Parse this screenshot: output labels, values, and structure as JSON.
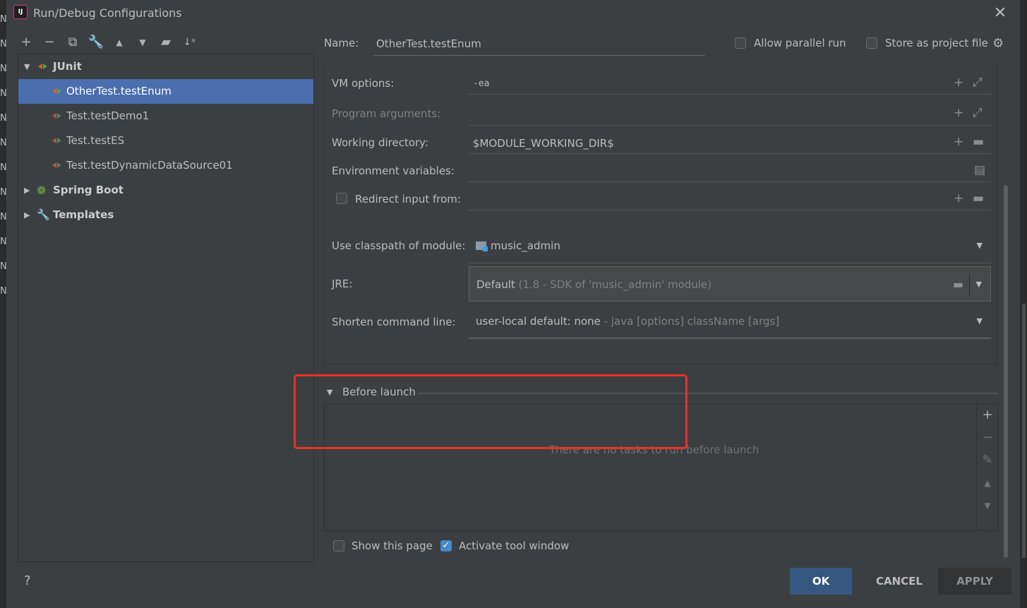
{
  "window": {
    "title": "Run/Debug Configurations",
    "app_icon": "intellij-icon",
    "close_icon": "close-icon"
  },
  "toolbar": {
    "icons": [
      "add-icon",
      "remove-icon",
      "copy-icon",
      "wrench-icon",
      "move-up-icon",
      "move-down-icon",
      "new-folder-icon",
      "sort-icon"
    ]
  },
  "tree": {
    "junit": {
      "label": "JUnit",
      "children": [
        "OtherTest.testEnum",
        "Test.testDemo1",
        "Test.testES",
        "Test.testDynamicDataSource01"
      ]
    },
    "spring_boot": "Spring Boot",
    "templates": "Templates"
  },
  "header": {
    "name_label": "Name:",
    "name_value": "OtherTest.testEnum",
    "allow_parallel": "Allow parallel run",
    "store_project": "Store as project file"
  },
  "form": {
    "vm_options_label": "VM options:",
    "vm_options_value": "-ea",
    "program_args_label": "Program arguments:",
    "program_args_value": "",
    "working_dir_label": "Working directory:",
    "working_dir_value": "$MODULE_WORKING_DIR$",
    "env_label": "Environment variables:",
    "env_value": "",
    "redirect_label": "Redirect input from:",
    "classpath_label": "Use classpath of module:",
    "classpath_value": "music_admin",
    "jre_label": "JRE:",
    "jre_value": "Default",
    "jre_hint": "(1.8 - SDK of 'music_admin' module)",
    "shorten_label": "Shorten command line:",
    "shorten_value": "user-local default: none",
    "shorten_hint": "- java [options] className [args]"
  },
  "before_launch": {
    "title": "Before launch",
    "empty_text": "There are no tasks to run before launch",
    "show_page": "Show this page",
    "activate_tool": "Activate tool window"
  },
  "buttons": {
    "help": "?",
    "ok": "OK",
    "cancel": "CANCEL",
    "apply": "APPLY"
  },
  "colors": {
    "accent": "#4b6eaf",
    "ok_button": "#365880",
    "highlight_box": "#e8302a"
  }
}
